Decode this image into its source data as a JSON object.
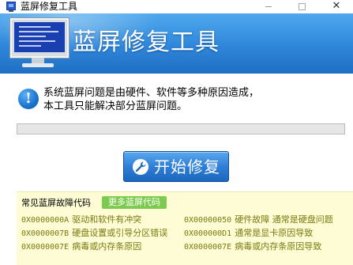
{
  "window": {
    "title": "蓝屏修复工具",
    "minimize_icon": "minimize-icon",
    "maximize_icon": "maximize-icon",
    "close_icon": "close-icon",
    "close_glyph": "✕"
  },
  "banner": {
    "title": "蓝屏修复工具",
    "icon": "monitor-icon"
  },
  "info": {
    "icon_glyph": "!",
    "line1": "系统蓝屏问题是由硬件、软件等多种原因造成，",
    "line2": "本工具只能解决部分蓝屏问题。"
  },
  "progress": {
    "value": 0
  },
  "start_button": {
    "label": "开始修复",
    "icon": "wrench-icon"
  },
  "codes": {
    "title": "常见蓝屏故障代码",
    "more_label": "更多蓝屏代码",
    "items": [
      {
        "code": "0X0000000A",
        "desc": "驱动和软件有冲突"
      },
      {
        "code": "0X0000007B",
        "desc": "硬盘设置或引导分区错误"
      },
      {
        "code": "0X0000007E",
        "desc": "病毒或内存条原因"
      },
      {
        "code": "0X00000050",
        "desc": "硬件故障 通常是硬盘问题"
      },
      {
        "code": "0X000000D1",
        "desc": "通常是显卡原因导致"
      },
      {
        "code": "0X0000007E",
        "desc": "病毒或内存条原因导致"
      }
    ]
  },
  "colors": {
    "banner_top": "#4fa9ee",
    "banner_bottom": "#1f6fc4",
    "button_blue": "#2f7fd6",
    "panel_bg": "#fdfcd4",
    "code_text": "#7a7a10",
    "more_button": "#7ccb4e"
  }
}
